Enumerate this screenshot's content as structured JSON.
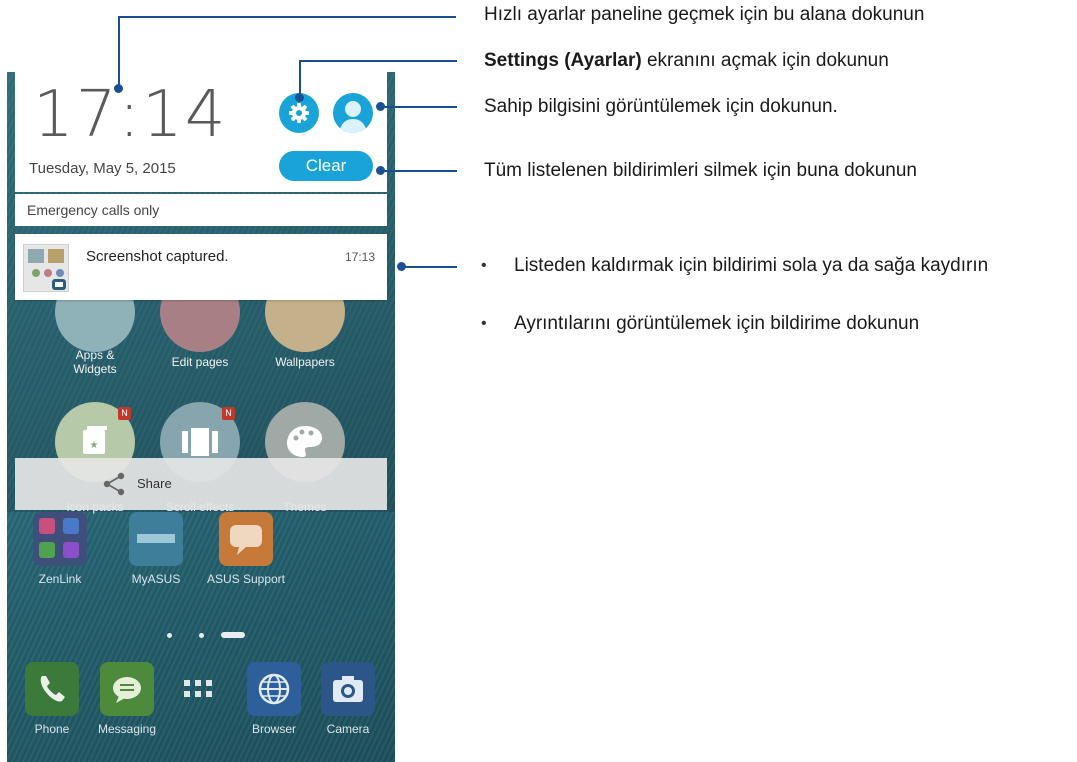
{
  "annotations": {
    "quick_settings": "Hızlı ayarlar paneline geçmek için bu alana dokunun",
    "settings_bold": "Settings (Ayarlar)",
    "settings_rest": " ekranını açmak için dokunun",
    "owner": "Sahip bilgisini görüntülemek için dokunun.",
    "clear": "Tüm listelenen bildirimleri silmek için buna dokunun",
    "bullets": [
      "Listeden kaldırmak için bildirimi sola ya da sağa kaydırın",
      "Ayrıntılarını görüntülemek için bildirime dokunun"
    ],
    "bullet_char": "•",
    "accent_color": "#1b4f93"
  },
  "panel": {
    "time": "17:14",
    "date": "Tuesday, May 5, 2015",
    "clear_label": "Clear",
    "status": "Emergency calls only",
    "settings_icon": "gear-icon",
    "avatar_icon": "user-avatar-icon",
    "accent_color": "#1aa3d9"
  },
  "notification": {
    "title": "Screenshot captured.",
    "time": "17:13",
    "icon": "screenshot-thumbnail"
  },
  "home_menu": {
    "items": [
      {
        "label": "Apps &\nWidgets"
      },
      {
        "label": "Edit pages"
      },
      {
        "label": "Wallpapers"
      },
      {
        "label": "Icon packs",
        "badge": "N"
      },
      {
        "label": "Scroll effects",
        "badge": "N"
      },
      {
        "label": "Themes"
      }
    ],
    "share_label": "Share"
  },
  "home_apps": [
    {
      "label": "ZenLink"
    },
    {
      "label": "MyASUS"
    },
    {
      "label": "ASUS Support"
    }
  ],
  "dock": [
    {
      "label": "Phone"
    },
    {
      "label": "Messaging"
    },
    {
      "label": ""
    },
    {
      "label": "Browser"
    },
    {
      "label": "Camera"
    }
  ]
}
